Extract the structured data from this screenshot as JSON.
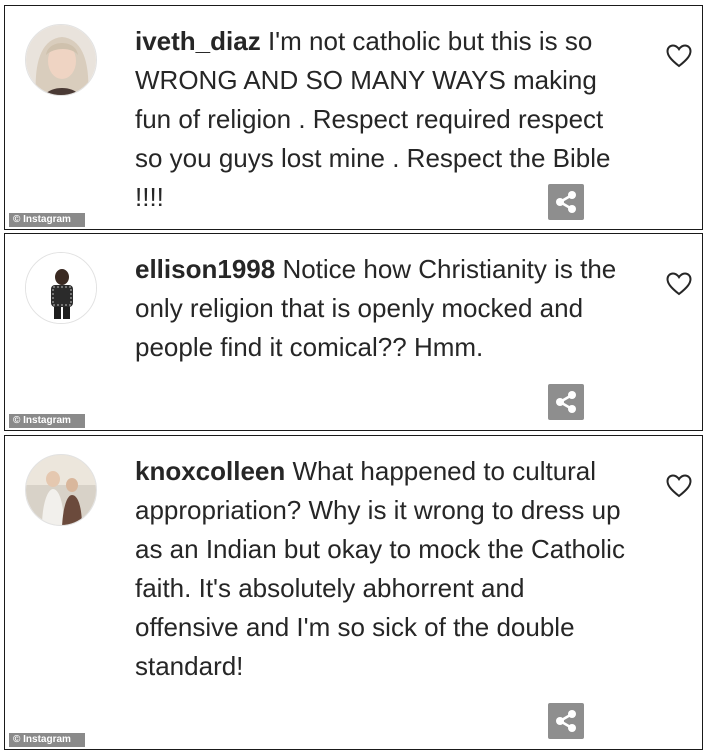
{
  "comments": [
    {
      "username": "iveth_diaz",
      "text": "I'm not catholic but this is so WRONG AND SO MANY WAYS making fun of religion . Respect required respect so you guys lost mine . Respect the Bible !!!!",
      "watermark": "© Instagram"
    },
    {
      "username": "ellison1998",
      "text": "Notice how Christianity is the only religion that is openly mocked and people find it comical?? Hmm.",
      "watermark": "© Instagram"
    },
    {
      "username": "knoxcolleen",
      "text": "What happened to cultural appropriation? Why is it wrong to dress up as an Indian but okay to mock the Catholic faith. It's absolutely abhorrent and offensive and I'm so sick of the double standard!",
      "watermark": "© Instagram"
    }
  ],
  "icons": {
    "like": "heart-icon",
    "share": "share-icon"
  },
  "colors": {
    "text": "#262626",
    "share_bg": "#8e8e8e",
    "watermark_bg": "#8a8a8a",
    "border": "#1a1a1a"
  }
}
